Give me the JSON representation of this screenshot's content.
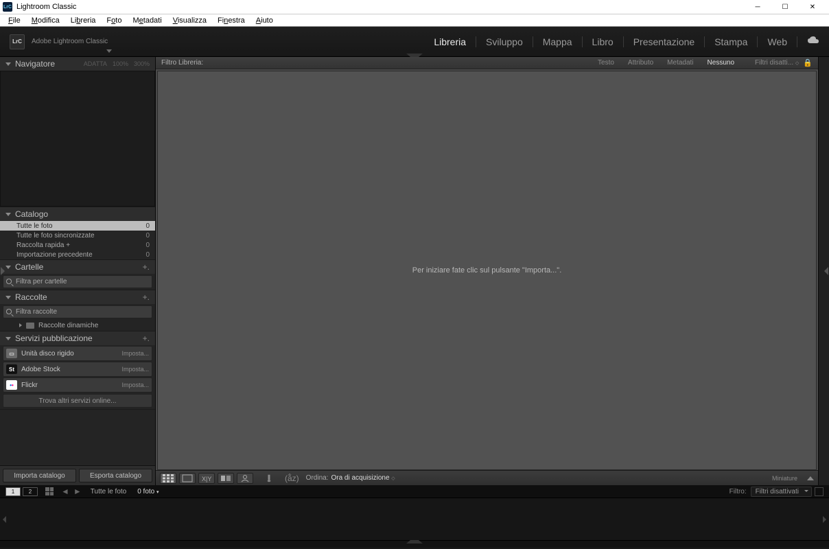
{
  "titlebar": {
    "title": "Lightroom Classic",
    "logo": "LrC"
  },
  "menubar": {
    "items": [
      {
        "pre": "",
        "u": "F",
        "post": "ile"
      },
      {
        "pre": "",
        "u": "M",
        "post": "odifica"
      },
      {
        "pre": "Li",
        "u": "b",
        "post": "reria"
      },
      {
        "pre": "F",
        "u": "o",
        "post": "to"
      },
      {
        "pre": "M",
        "u": "e",
        "post": "tadati"
      },
      {
        "pre": "",
        "u": "V",
        "post": "isualizza"
      },
      {
        "pre": "Fi",
        "u": "n",
        "post": "estra"
      },
      {
        "pre": "",
        "u": "A",
        "post": "iuto"
      }
    ]
  },
  "header": {
    "brand": "Adobe Lightroom Classic",
    "logo": "LrC",
    "modules": [
      "Libreria",
      "Sviluppo",
      "Mappa",
      "Libro",
      "Presentazione",
      "Stampa",
      "Web"
    ],
    "active": "Libreria"
  },
  "navigator": {
    "title": "Navigatore",
    "opts": [
      "ADATTA",
      "100%",
      "300%"
    ]
  },
  "catalog": {
    "title": "Catalogo",
    "rows": [
      {
        "label": "Tutte le foto",
        "count": "0",
        "sel": true
      },
      {
        "label": "Tutte le foto sincronizzate",
        "count": "0",
        "sel": false
      },
      {
        "label": "Raccolta rapida +",
        "count": "0",
        "sel": false
      },
      {
        "label": "Importazione precedente",
        "count": "0",
        "sel": false
      }
    ]
  },
  "folders": {
    "title": "Cartelle",
    "filter_placeholder": "Filtra per cartelle"
  },
  "collections": {
    "title": "Raccolte",
    "filter_placeholder": "Filtra raccolte",
    "smart": "Raccolte dinamiche"
  },
  "publish": {
    "title": "Servizi pubblicazione",
    "rows": [
      {
        "name": "Unità disco rigido",
        "icon": "hdd",
        "setup": "Imposta..."
      },
      {
        "name": "Adobe Stock",
        "icon": "st",
        "setup": "Imposta..."
      },
      {
        "name": "Flickr",
        "icon": "fl",
        "setup": "Imposta..."
      }
    ],
    "find_more": "Trova altri servizi online..."
  },
  "buttons": {
    "import": "Importa catalogo",
    "export": "Esporta catalogo"
  },
  "filterbar": {
    "label": "Filtro Libreria:",
    "tabs": [
      "Testo",
      "Attributo",
      "Metadati",
      "Nessuno"
    ],
    "active": "Nessuno",
    "off": "Filtri disatti..."
  },
  "canvas": {
    "empty_text": "Per iniziare fate clic sul pulsante \"Importa...\"."
  },
  "toolbar": {
    "sort_label": "Ordina:",
    "sort_value": "Ora di acquisizione",
    "thumb_label": "Miniature"
  },
  "secbar": {
    "mon1": "1",
    "mon2": "2",
    "source": "Tutte le foto",
    "count": "0 foto",
    "filter_label": "Filtro:",
    "filter_value": "Filtri disattivati"
  }
}
